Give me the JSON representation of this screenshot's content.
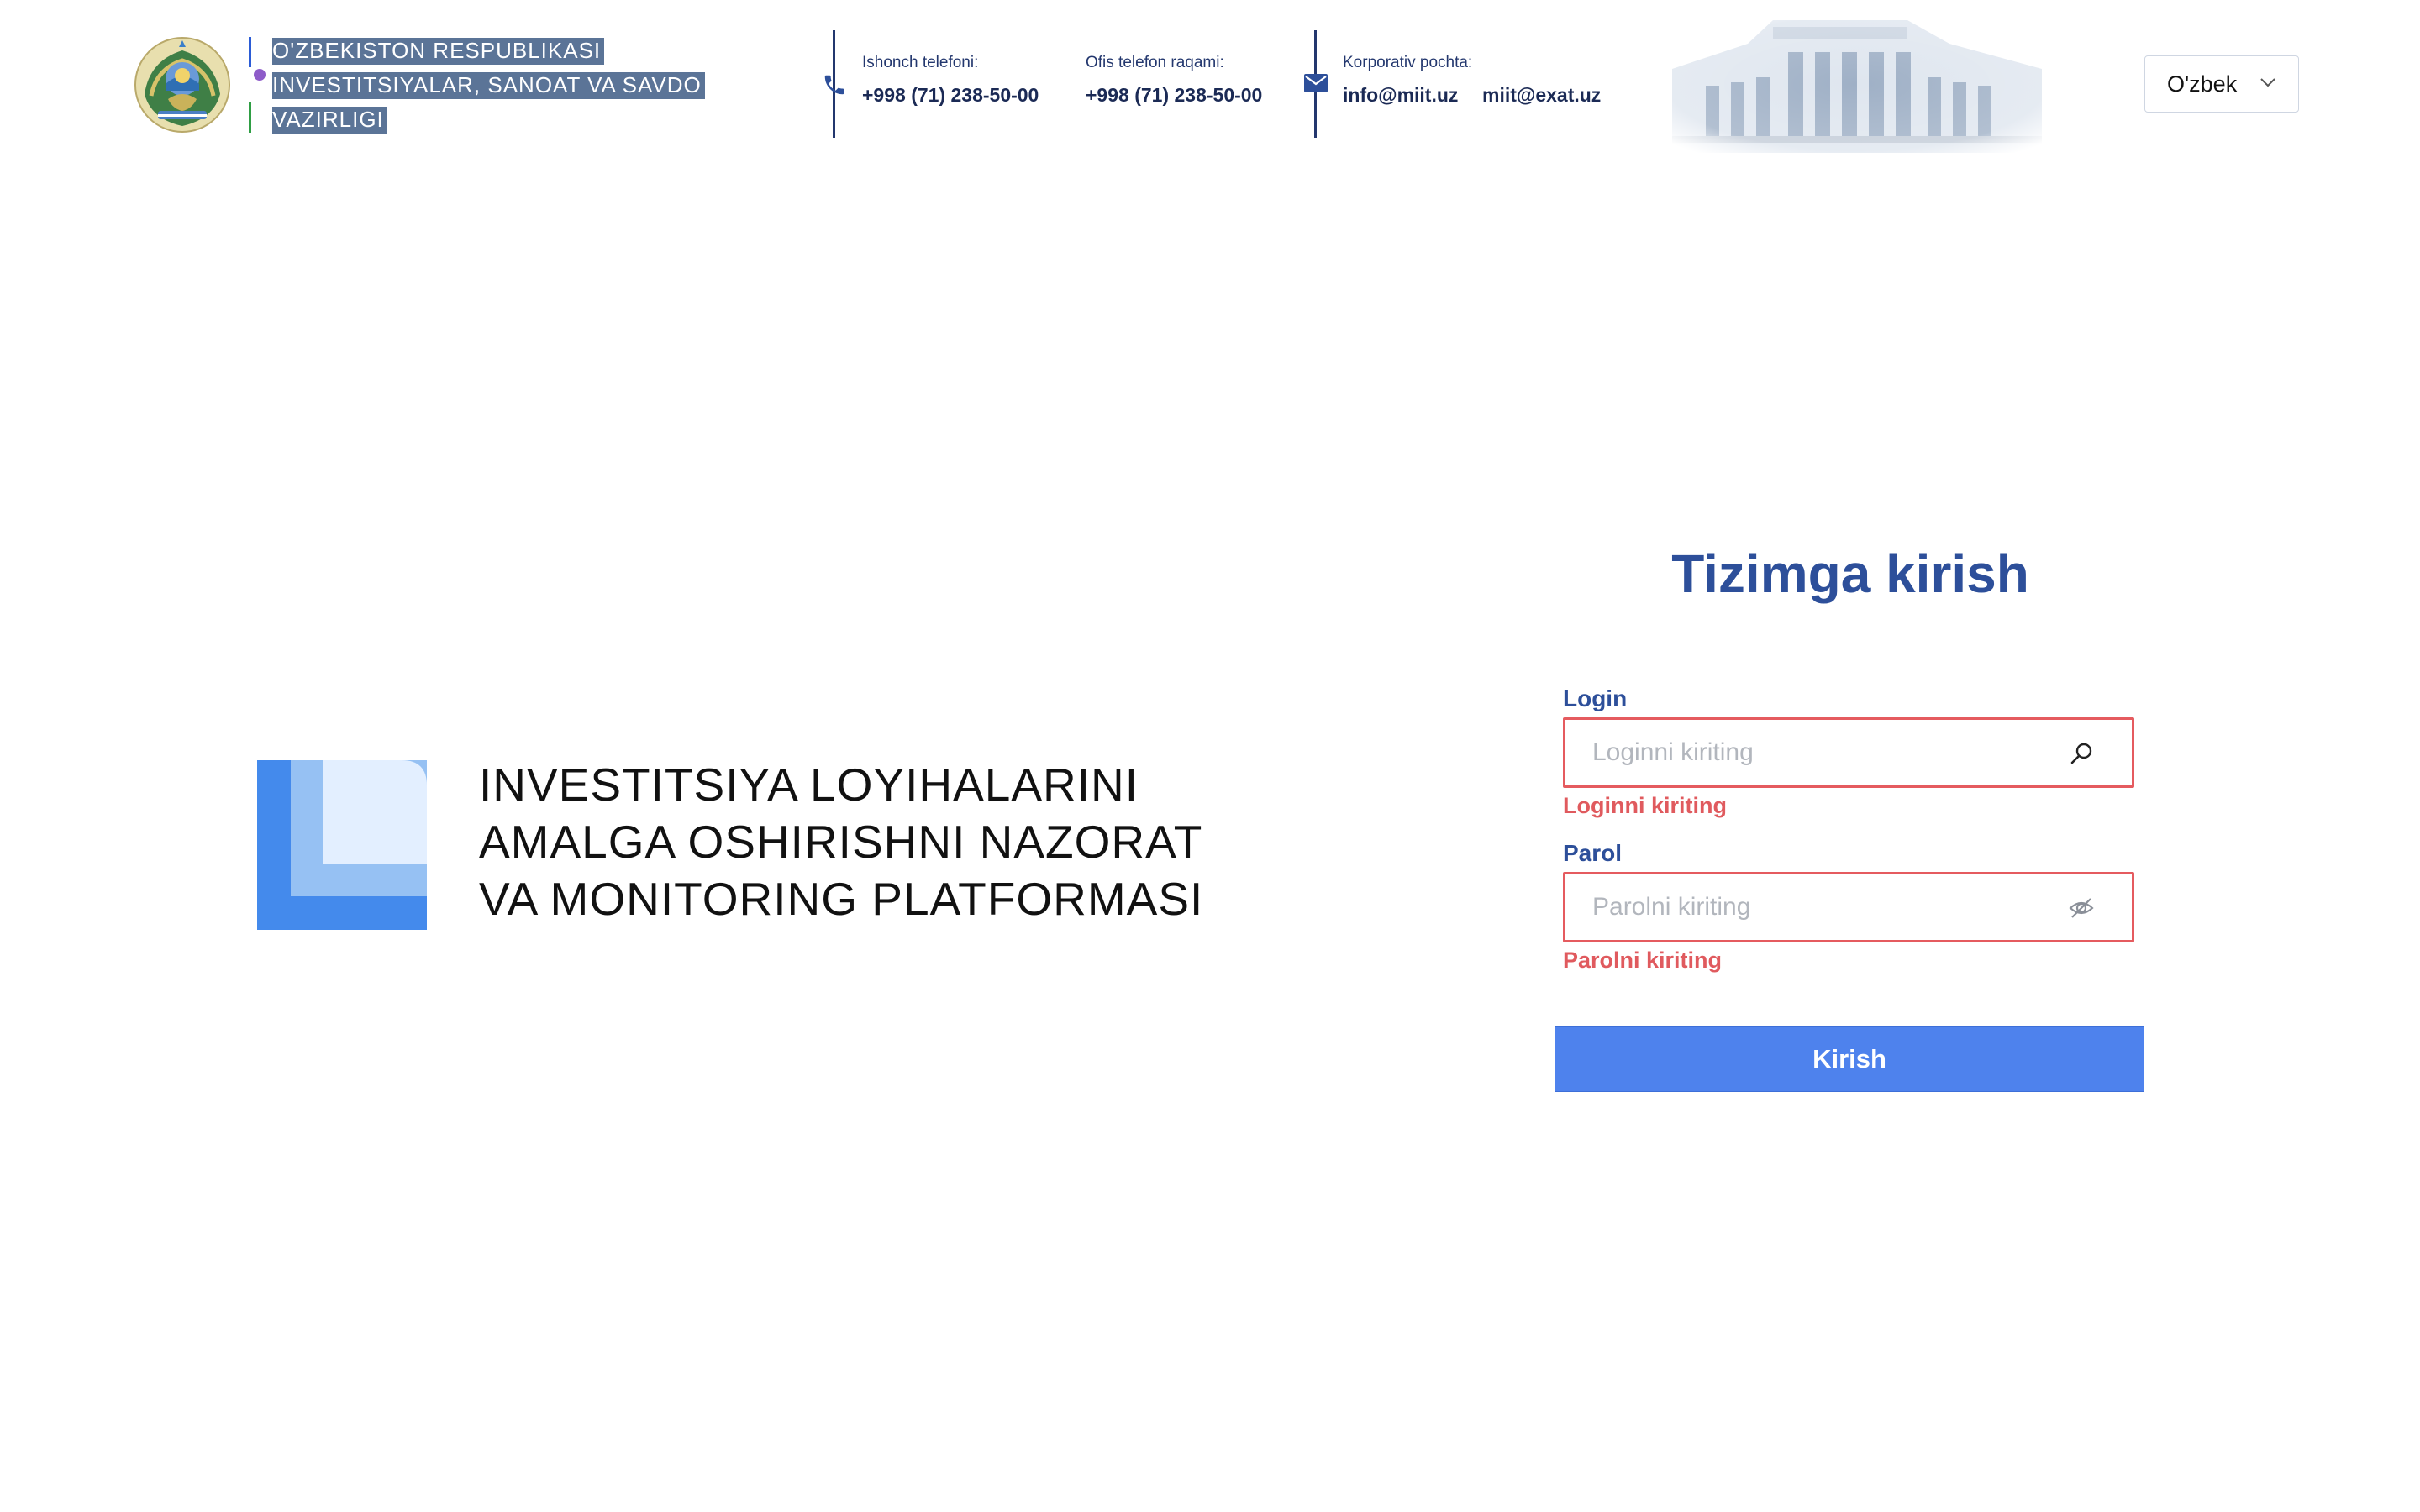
{
  "header": {
    "ministry_name": "O'ZBEKISTON RESPUBLIKASI INVESTITSIYALAR, SANOAT VA SAVDO VAZIRLIGI",
    "hotline_label": "Ishonch telefoni:",
    "hotline_value": "+998 (71) 238-50-00",
    "office_label": "Ofis telefon raqami:",
    "office_value": "+998 (71) 238-50-00",
    "email_label": "Korporativ pochta:",
    "email_primary": "info@miit.uz",
    "email_secondary": "miit@exat.uz",
    "language": "O'zbek"
  },
  "platform": {
    "title": "INVESTITSIYA LOYIHALARINI AMALGA OSHIRISHNI NAZORAT VA MONITORING PLATFORMASI"
  },
  "login": {
    "title": "Tizimga kirish",
    "login_label": "Login",
    "login_placeholder": "Loginni kiriting",
    "login_error": "Loginni kiriting",
    "password_label": "Parol",
    "password_placeholder": "Parolni kiriting",
    "password_error": "Parolni kiriting",
    "submit_label": "Kirish"
  },
  "icons": {
    "phone": "phone-icon",
    "mail": "mail-icon",
    "search": "search-icon",
    "eye_off": "eye-off-icon",
    "chevron": "chevron-down-icon"
  },
  "colors": {
    "brand_blue": "#2d4f9a",
    "error_red": "#e05a5e",
    "button_blue": "#4e82ed",
    "ministry_highlight": "#5b7497"
  }
}
